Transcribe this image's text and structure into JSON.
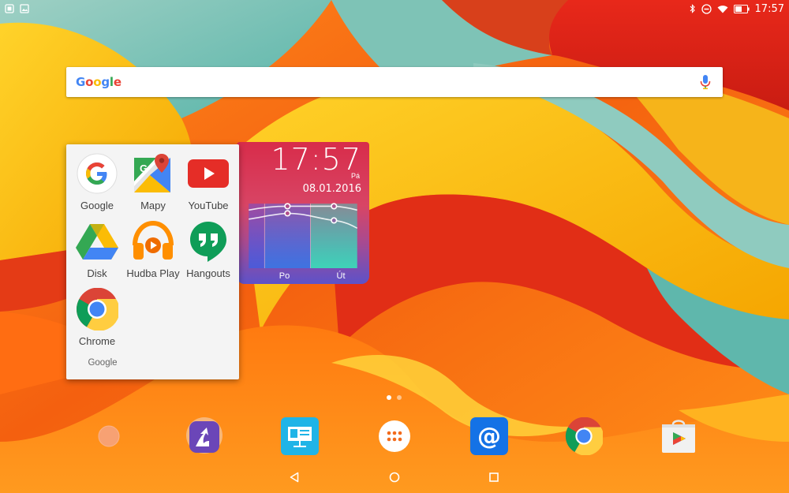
{
  "status_bar": {
    "time": "17:57",
    "left_icons": [
      "notification-icon",
      "gallery-icon"
    ],
    "right_icons": [
      "bluetooth-icon",
      "do-not-disturb-icon",
      "wifi-icon",
      "battery-icon"
    ]
  },
  "search": {
    "brand": [
      "G",
      "o",
      "o",
      "g",
      "l",
      "e"
    ],
    "brand_colors": [
      "#4285F4",
      "#EA4335",
      "#FBBC05",
      "#4285F4",
      "#34A853",
      "#EA4335"
    ],
    "placeholder": "",
    "value": "",
    "icon": "mic-icon"
  },
  "clock_widget": {
    "time": "17:57",
    "day": "Pá",
    "date": "08.01.2016",
    "forecast_days": [
      "Po",
      "Út"
    ]
  },
  "folder": {
    "name": "Google",
    "apps": [
      {
        "label": "Google",
        "icon": "google-app-icon"
      },
      {
        "label": "Mapy",
        "icon": "maps-icon"
      },
      {
        "label": "YouTube",
        "icon": "youtube-icon"
      },
      {
        "label": "Disk",
        "icon": "drive-icon"
      },
      {
        "label": "Hudba Play",
        "icon": "play-music-icon"
      },
      {
        "label": "Hangouts",
        "icon": "hangouts-icon"
      },
      {
        "label": "Chrome",
        "icon": "chrome-icon"
      }
    ]
  },
  "page_indicator": {
    "pages": 2,
    "current": 1
  },
  "dock": {
    "items": [
      "peach-app-icon",
      "shareit-icon",
      "presentation-icon",
      "app-drawer-icon",
      "email-icon",
      "chrome-icon",
      "play-store-icon"
    ]
  },
  "nav_bar": {
    "items": [
      "back-icon",
      "home-icon",
      "recents-icon"
    ]
  }
}
